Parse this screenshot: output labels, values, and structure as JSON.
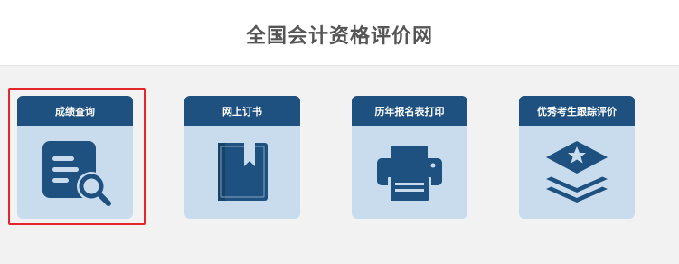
{
  "site": {
    "title": "全国会计资格评价网"
  },
  "cards": [
    {
      "label": "成绩查询",
      "icon": "document-search-icon",
      "selected": true
    },
    {
      "label": "网上订书",
      "icon": "book-bookmark-icon",
      "selected": false
    },
    {
      "label": "历年报名表打印",
      "icon": "printer-icon",
      "selected": false
    },
    {
      "label": "优秀考生跟踪评价",
      "icon": "star-layers-icon",
      "selected": false
    }
  ],
  "colors": {
    "header_bg": "#1e5180",
    "card_bg": "#c9dcee",
    "icon": "#1e5180",
    "highlight": "#e3262b",
    "page_bg": "#f2f2f2",
    "title_text": "#555555"
  }
}
